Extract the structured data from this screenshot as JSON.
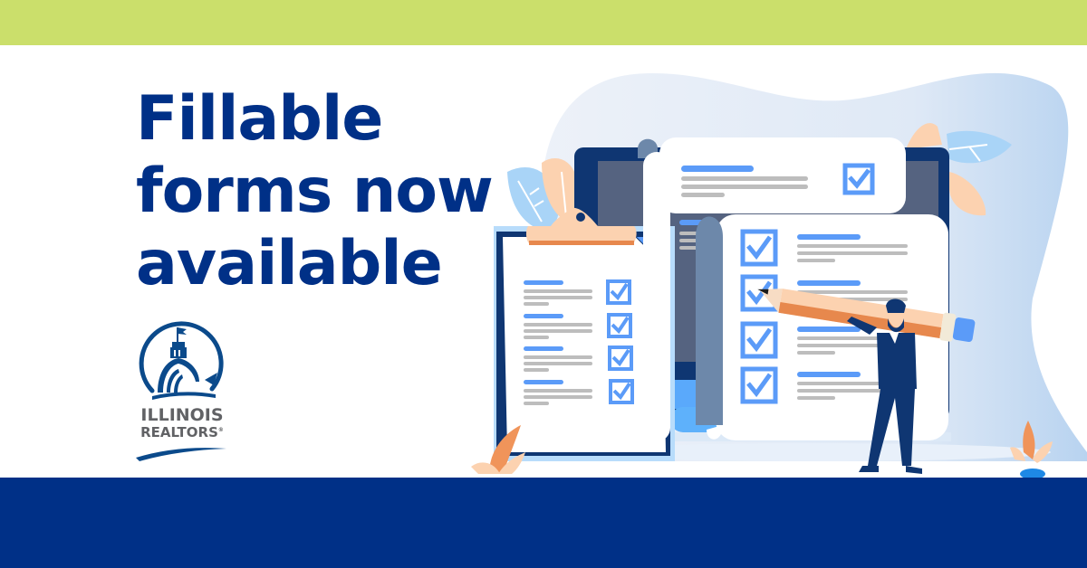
{
  "banner": {
    "headline_lines": [
      "Fillable",
      "forms now",
      "available"
    ],
    "colors": {
      "top_band": "#cbdf6b",
      "bottom_band": "#003087",
      "headline": "#003087",
      "accent_blue": "#5b9bf8",
      "placeholder_gray": "#bdbdbd",
      "peach": "#fcd2b0",
      "orange": "#f0945a"
    }
  },
  "logo": {
    "line1": "ILLINOIS",
    "line2": "REALTORS",
    "registered_mark": "®",
    "icon": "capitol-dome-icon"
  },
  "illustration": {
    "clipboard_rows_checked": 4,
    "scroll_top_rows_checked": 1,
    "scroll_main_rows_checked": 4,
    "description": "person carrying large pencil in front of monitor with checklist forms"
  }
}
